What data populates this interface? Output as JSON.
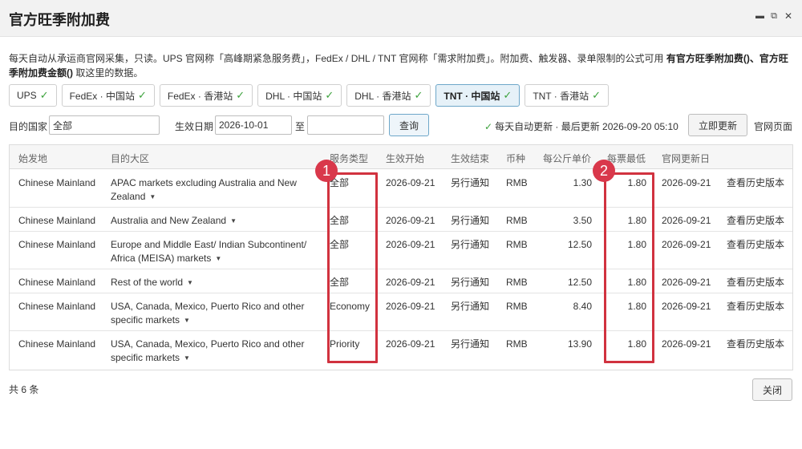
{
  "window": {
    "title": "官方旺季附加费",
    "controls": {
      "minimize": "▬",
      "restore": "⧉",
      "close": "✕"
    }
  },
  "intro": {
    "part1": "每天自动从承运商官网采集，只读。UPS 官网称「高峰期紧急服务费」，FedEx / DHL / TNT 官网称「需求附加费」。附加费、触发器、录单限制的公式可用 ",
    "bold": "有官方旺季附加费()、官方旺季附加费金额()",
    "part2": " 取这里的数据。"
  },
  "tabs": [
    {
      "label": "UPS",
      "check": "✓"
    },
    {
      "label": "FedEx · 中国站",
      "check": "✓"
    },
    {
      "label": "FedEx · 香港站",
      "check": "✓"
    },
    {
      "label": "DHL · 中国站",
      "check": "✓"
    },
    {
      "label": "DHL · 香港站",
      "check": "✓"
    },
    {
      "label": "TNT · 中国站",
      "check": "✓"
    },
    {
      "label": "TNT · 香港站",
      "check": "✓"
    }
  ],
  "active_tab": "TNT · 中国站",
  "filter": {
    "country_label": "目的国家",
    "country_value": "全部",
    "date_label": "生效日期",
    "date_from": "2026-10-01",
    "date_sep": "至",
    "date_to": "",
    "query_button": "查询",
    "status_check": "✓",
    "status_text": "每天自动更新 · 最后更新 2026-09-20 05:10",
    "update_button": "立即更新",
    "official_link": "官网页面"
  },
  "table": {
    "headers": [
      "始发地",
      "目的大区",
      "服务类型",
      "生效开始",
      "生效结束",
      "币种",
      "每公斤单价",
      "每票最低",
      "官网更新日",
      ""
    ],
    "caret": "▼",
    "rows": [
      {
        "origin": "Chinese Mainland",
        "dest": "APAC markets excluding Australia and New Zealand",
        "service": "全部",
        "start": "2026-09-21",
        "end": "另行通知",
        "currency": "RMB",
        "unit_price": "1.30",
        "min_per_ticket": "1.80",
        "updated": "2026-09-21",
        "action": "查看历史版本"
      },
      {
        "origin": "Chinese Mainland",
        "dest": "Australia and New Zealand",
        "service": "全部",
        "start": "2026-09-21",
        "end": "另行通知",
        "currency": "RMB",
        "unit_price": "3.50",
        "min_per_ticket": "1.80",
        "updated": "2026-09-21",
        "action": "查看历史版本"
      },
      {
        "origin": "Chinese Mainland",
        "dest": "Europe and Middle East/ Indian Subcontinent/ Africa (MEISA) markets",
        "service": "全部",
        "start": "2026-09-21",
        "end": "另行通知",
        "currency": "RMB",
        "unit_price": "12.50",
        "min_per_ticket": "1.80",
        "updated": "2026-09-21",
        "action": "查看历史版本"
      },
      {
        "origin": "Chinese Mainland",
        "dest": "Rest of the world",
        "service": "全部",
        "start": "2026-09-21",
        "end": "另行通知",
        "currency": "RMB",
        "unit_price": "12.50",
        "min_per_ticket": "1.80",
        "updated": "2026-09-21",
        "action": "查看历史版本"
      },
      {
        "origin": "Chinese Mainland",
        "dest": "USA, Canada, Mexico, Puerto Rico and other specific markets",
        "service": "Economy",
        "start": "2026-09-21",
        "end": "另行通知",
        "currency": "RMB",
        "unit_price": "8.40",
        "min_per_ticket": "1.80",
        "updated": "2026-09-21",
        "action": "查看历史版本"
      },
      {
        "origin": "Chinese Mainland",
        "dest": "USA, Canada, Mexico, Puerto Rico and other specific markets",
        "service": "Priority",
        "start": "2026-09-21",
        "end": "另行通知",
        "currency": "RMB",
        "unit_price": "13.90",
        "min_per_ticket": "1.80",
        "updated": "2026-09-21",
        "action": "查看历史版本"
      }
    ]
  },
  "footer": {
    "count": "共 6 条",
    "close_button": "关闭"
  },
  "annotations": {
    "marker1": "1",
    "marker2": "2"
  },
  "colors": {
    "highlight": "#d1323f",
    "marker": "#d9384b",
    "check": "#3ca23c",
    "active_tab_bg": "#e6f1f8"
  }
}
